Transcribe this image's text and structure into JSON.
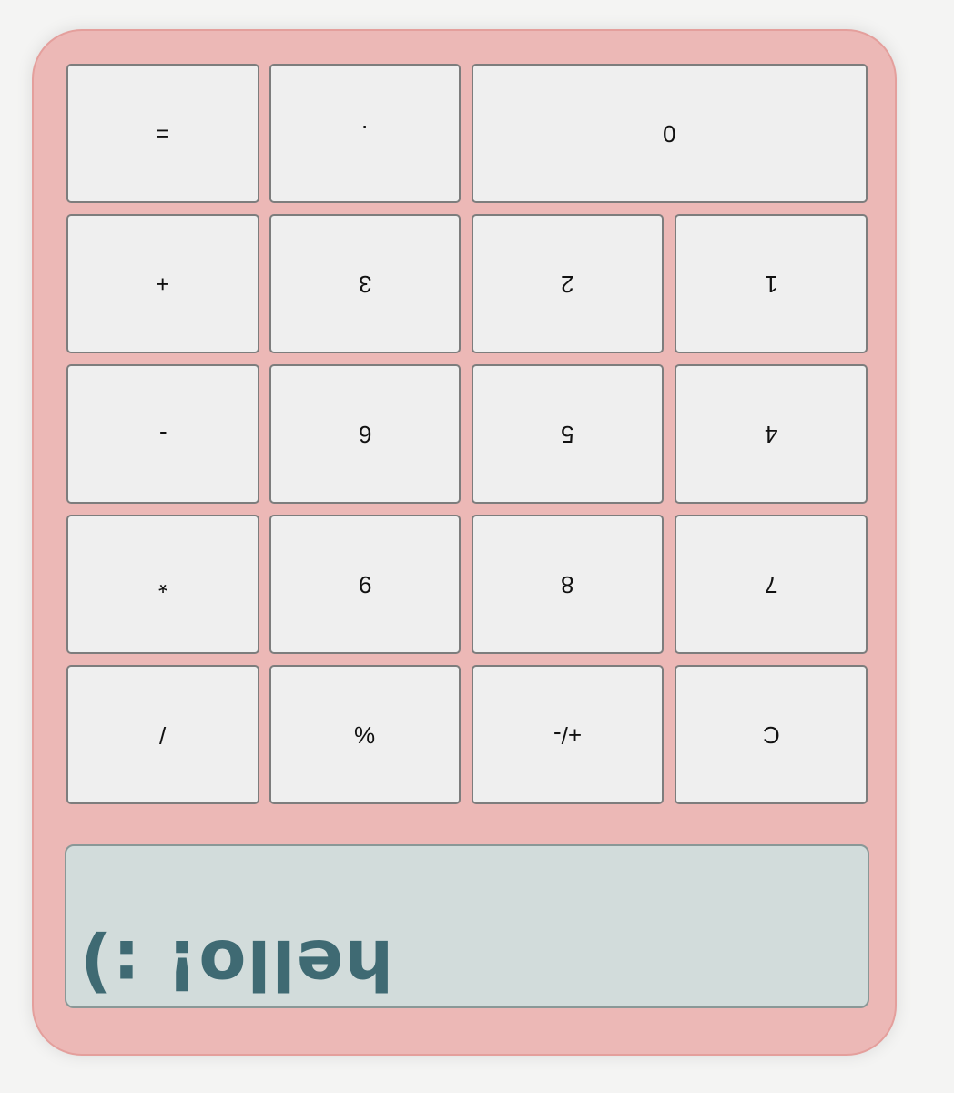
{
  "calculator": {
    "keys": [
      {
        "id": "equals",
        "label": "="
      },
      {
        "id": "decimal",
        "label": "."
      },
      {
        "id": "zero",
        "label": "0"
      },
      {
        "id": "plus",
        "label": "+"
      },
      {
        "id": "three",
        "label": "3"
      },
      {
        "id": "two",
        "label": "2"
      },
      {
        "id": "one",
        "label": "1"
      },
      {
        "id": "minus",
        "label": "-"
      },
      {
        "id": "six",
        "label": "6"
      },
      {
        "id": "five",
        "label": "5"
      },
      {
        "id": "four",
        "label": "4"
      },
      {
        "id": "multiply",
        "label": "*"
      },
      {
        "id": "nine",
        "label": "9"
      },
      {
        "id": "eight",
        "label": "8"
      },
      {
        "id": "seven",
        "label": "7"
      },
      {
        "id": "divide",
        "label": "/"
      },
      {
        "id": "percent",
        "label": "%"
      },
      {
        "id": "sign",
        "label": "+/-"
      },
      {
        "id": "clear",
        "label": "C"
      }
    ],
    "display": {
      "text": "hello! :)"
    }
  },
  "colors": {
    "body": "#ecb8b6",
    "key": "#efefef",
    "display": "#d2dcdb",
    "display_text": "#3f6a73"
  }
}
